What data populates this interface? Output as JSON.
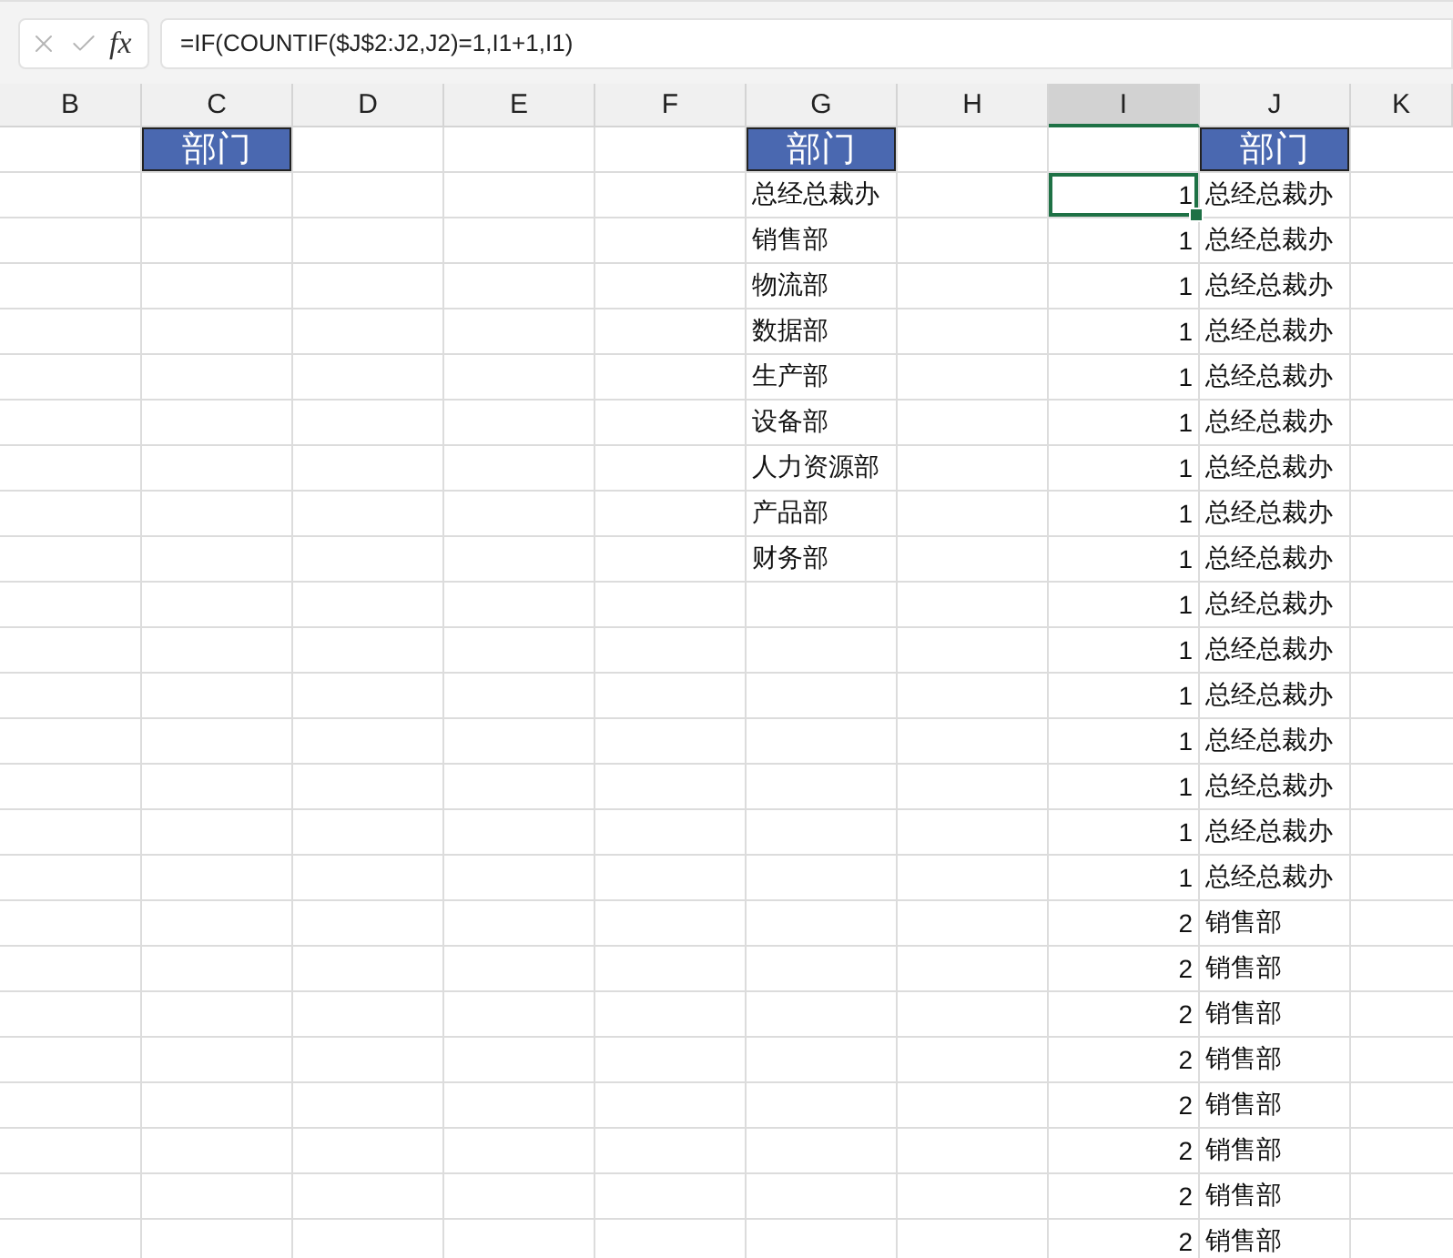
{
  "formula_bar": {
    "fx_label": "fx",
    "formula": "=IF(COUNTIF($J$2:J2,J2)=1,I1+1,I1)"
  },
  "columns": [
    {
      "label": "B",
      "selected": false
    },
    {
      "label": "C",
      "selected": false
    },
    {
      "label": "D",
      "selected": false
    },
    {
      "label": "E",
      "selected": false
    },
    {
      "label": "F",
      "selected": false
    },
    {
      "label": "G",
      "selected": false
    },
    {
      "label": "H",
      "selected": false
    },
    {
      "label": "I",
      "selected": true
    },
    {
      "label": "J",
      "selected": false
    },
    {
      "label": "K",
      "selected": false
    }
  ],
  "header_row": {
    "c": "部门",
    "g": "部门",
    "j": "部门"
  },
  "rows": [
    {
      "g": "总经总裁办",
      "i": "1",
      "j": "总经总裁办",
      "selected": true
    },
    {
      "g": "销售部",
      "i": "1",
      "j": "总经总裁办",
      "selected": false
    },
    {
      "g": "物流部",
      "i": "1",
      "j": "总经总裁办",
      "selected": false
    },
    {
      "g": "数据部",
      "i": "1",
      "j": "总经总裁办",
      "selected": false
    },
    {
      "g": "生产部",
      "i": "1",
      "j": "总经总裁办",
      "selected": false
    },
    {
      "g": "设备部",
      "i": "1",
      "j": "总经总裁办",
      "selected": false
    },
    {
      "g": "人力资源部",
      "i": "1",
      "j": "总经总裁办",
      "selected": false
    },
    {
      "g": "产品部",
      "i": "1",
      "j": "总经总裁办",
      "selected": false
    },
    {
      "g": "财务部",
      "i": "1",
      "j": "总经总裁办",
      "selected": false
    },
    {
      "i": "1",
      "j": "总经总裁办",
      "selected": false
    },
    {
      "i": "1",
      "j": "总经总裁办",
      "selected": false
    },
    {
      "i": "1",
      "j": "总经总裁办",
      "selected": false
    },
    {
      "i": "1",
      "j": "总经总裁办",
      "selected": false
    },
    {
      "i": "1",
      "j": "总经总裁办",
      "selected": false
    },
    {
      "i": "1",
      "j": "总经总裁办",
      "selected": false
    },
    {
      "i": "1",
      "j": "总经总裁办",
      "selected": false
    },
    {
      "i": "2",
      "j": "销售部",
      "selected": false
    },
    {
      "i": "2",
      "j": "销售部",
      "selected": false
    },
    {
      "i": "2",
      "j": "销售部",
      "selected": false
    },
    {
      "i": "2",
      "j": "销售部",
      "selected": false
    },
    {
      "i": "2",
      "j": "销售部",
      "selected": false
    },
    {
      "i": "2",
      "j": "销售部",
      "selected": false
    },
    {
      "i": "2",
      "j": "销售部",
      "selected": false
    },
    {
      "i": "2",
      "j": "销售部",
      "selected": false
    }
  ]
}
